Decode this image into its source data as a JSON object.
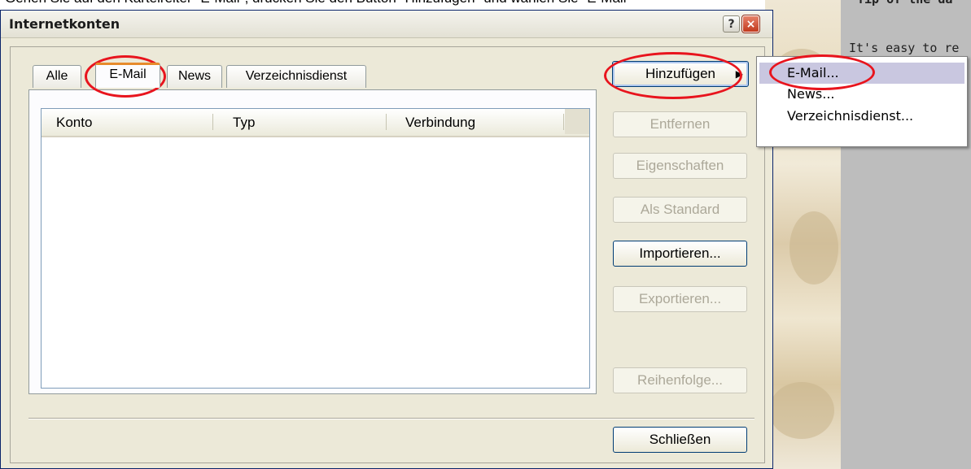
{
  "caption": "Gehen Sie auf den Karteireiter \"E-Mail\", drücken Sie den Button \"Hinzufügen\" und wählen Sie \"E-Mail\"",
  "background": {
    "tip_title": "Tip of the da",
    "tip_text": "It's easy to re"
  },
  "window": {
    "title": "Internetkonten",
    "help_glyph": "?",
    "close_glyph": "×"
  },
  "tabs": [
    {
      "label": "Alle",
      "active": false
    },
    {
      "label": "E-Mail",
      "active": true
    },
    {
      "label": "News",
      "active": false
    },
    {
      "label": "Verzeichnisdienst",
      "active": false
    }
  ],
  "list": {
    "columns": [
      "Konto",
      "Typ",
      "Verbindung"
    ],
    "rows": []
  },
  "buttons": {
    "add": "Hinzufügen",
    "remove": "Entfernen",
    "properties": "Eigenschaften",
    "set_default": "Als Standard",
    "import": "Importieren...",
    "export": "Exportieren...",
    "order": "Reihenfolge...",
    "close": "Schließen"
  },
  "add_menu": {
    "items": [
      {
        "label": "E-Mail...",
        "selected": true
      },
      {
        "label": "News...",
        "selected": false
      },
      {
        "label": "Verzeichnisdienst...",
        "selected": false
      }
    ]
  },
  "colors": {
    "highlight_ring": "#e8141d",
    "menu_selection": "#c9c7e0",
    "active_tab_accent": "#e68b2c"
  }
}
